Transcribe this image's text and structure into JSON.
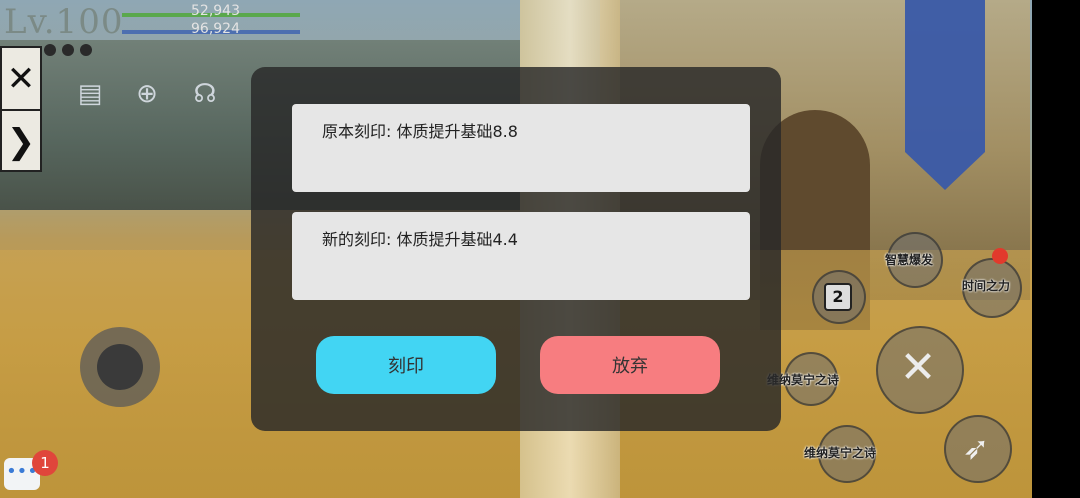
{
  "hud": {
    "level": "Lv.100",
    "hp": "52,943",
    "mp": "96,924",
    "hp_color": "#5aa84c",
    "mp_color": "#4d6fb0"
  },
  "side_panel": {
    "close_icon": "close-icon",
    "expand_icon": "chevron-right-icon"
  },
  "dialog": {
    "original_imprint": "原本刻印: 体质提升基础8.8",
    "new_imprint": "新的刻印: 体质提升基础4.4",
    "imprint_label": "刻印",
    "abandon_label": "放弃",
    "imprint_color": "#42d5f3",
    "abandon_color": "#f77d80"
  },
  "skills": {
    "wisdom_burst": "智慧爆发",
    "time_power": "时间之力",
    "slot_number": "2",
    "vina_poem_1": "维纳莫宁之诗",
    "vina_poem_2": "维纳莫宁之诗"
  },
  "chat": {
    "badge_count": "1"
  }
}
